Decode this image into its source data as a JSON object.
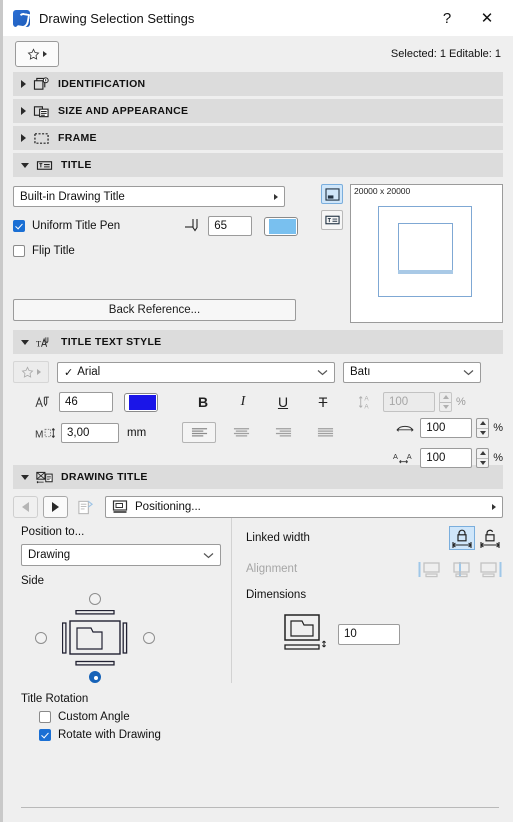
{
  "window": {
    "title": "Drawing Selection Settings",
    "help_label": "?",
    "close_label": "✕",
    "app_icon": "archicad-icon"
  },
  "topbar": {
    "favorites_icon": "star-icon",
    "favorites_caret": "caret-right-icon",
    "selection_info": "Selected: 1 Editable: 1"
  },
  "sections": [
    {
      "label": "IDENTIFICATION",
      "expanded": false,
      "icon": "identification-icon"
    },
    {
      "label": "SIZE AND APPEARANCE",
      "expanded": false,
      "icon": "size-appearance-icon"
    },
    {
      "label": "FRAME",
      "expanded": false,
      "icon": "frame-icon"
    },
    {
      "label": "TITLE",
      "expanded": true,
      "icon": "title-icon"
    },
    {
      "label": "TITLE TEXT STYLE",
      "expanded": true,
      "icon": "title-text-style-icon"
    },
    {
      "label": "DRAWING TITLE",
      "expanded": true,
      "icon": "drawing-title-icon"
    }
  ],
  "title_section": {
    "title_type": "Built-in Drawing Title",
    "uniform_pen_label": "Uniform Title Pen",
    "uniform_pen_checked": true,
    "pen_value": "65",
    "pen_color": "#79c0ef",
    "flip_title_label": "Flip Title",
    "flip_title_checked": false,
    "back_reference_label": "Back Reference...",
    "view_toggle_1": "title-below-icon",
    "view_toggle_2": "title-only-icon",
    "preview": {
      "size_label": "20000 x 20000",
      "line_color": "#7fa8d4"
    }
  },
  "text_style": {
    "favorites_icon": "star-icon",
    "font_family": "Arial",
    "font_check": "✓",
    "script": "Batı",
    "pen_value": "46",
    "text_color": "#1a15e8",
    "bold_label": "B",
    "italic_label": "I",
    "underline_label": "U",
    "strike_label": "T",
    "size_value": "3,00",
    "size_unit": "mm",
    "spacing": [
      {
        "icon": "line-spacing-icon",
        "value": "100",
        "unit": "%",
        "disabled": true
      },
      {
        "icon": "char-width-icon",
        "value": "100",
        "unit": "%",
        "disabled": false
      },
      {
        "icon": "char-spacing-icon",
        "value": "100",
        "unit": "%",
        "disabled": false
      }
    ],
    "alignments": [
      {
        "icon": "align-left-icon",
        "selected": true
      },
      {
        "icon": "align-center-icon",
        "selected": false
      },
      {
        "icon": "align-right-icon",
        "selected": false
      },
      {
        "icon": "align-justify-icon",
        "selected": false
      }
    ]
  },
  "drawing_title": {
    "prev_icon": "arrow-left-icon",
    "next_icon": "arrow-right-icon",
    "settings_icon": "title-settings-icon",
    "positioning_icon": "positioning-icon",
    "positioning_label": "Positioning...",
    "position_to_label": "Position to...",
    "position_to_value": "Drawing",
    "side_label": "Side",
    "side_selected": "bottom",
    "linked_width_label": "Linked width",
    "linked_width_selected": 0,
    "linked_width_options": [
      "linked-width-locked-icon",
      "linked-width-unlocked-icon"
    ],
    "alignment_label": "Alignment",
    "alignment_disabled": true,
    "alignment_options": [
      "align-title-left-icon",
      "align-title-center-icon",
      "align-title-right-icon"
    ],
    "dimensions_label": "Dimensions",
    "dimension_icon": "drawing-offset-icon",
    "dimension_value": "10"
  },
  "title_rotation": {
    "label": "Title Rotation",
    "custom_angle_label": "Custom Angle",
    "custom_angle_checked": false,
    "rotate_with_drawing_label": "Rotate with Drawing",
    "rotate_with_drawing_checked": true
  }
}
